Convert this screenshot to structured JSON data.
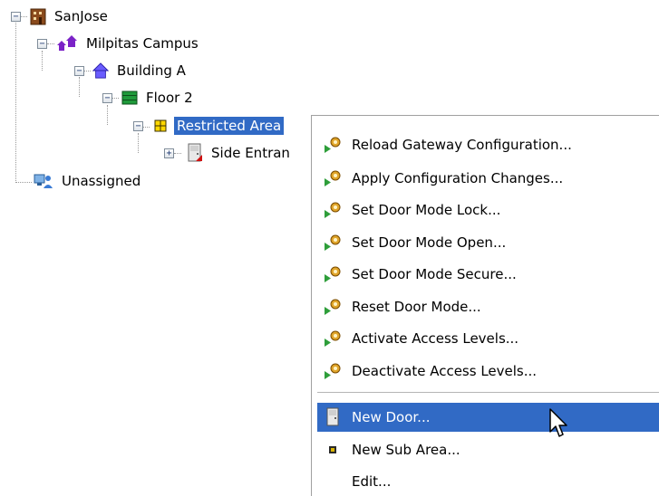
{
  "tree": {
    "root": {
      "label": "SanJose",
      "toggle": "−",
      "icon": "building-brown-icon"
    },
    "campus": {
      "label": "Milpitas Campus",
      "toggle": "−",
      "icon": "campus-houses-icon"
    },
    "building": {
      "label": "Building A",
      "toggle": "−",
      "icon": "house-blue-icon"
    },
    "floor": {
      "label": "Floor 2",
      "toggle": "−",
      "icon": "floor-green-icon"
    },
    "area": {
      "label": "Restricted Area",
      "toggle": "−",
      "icon": "area-yellow-icon"
    },
    "door": {
      "label": "Side Entran",
      "toggle": "+",
      "icon": "door-icon"
    },
    "unassigned": {
      "label": "Unassigned",
      "icon": "network-users-icon"
    }
  },
  "context_menu": {
    "items": [
      {
        "label": "Reload Gateway Configuration...",
        "icon": "gear-action-icon"
      },
      {
        "label": "Apply Configuration Changes...",
        "icon": "gear-action-icon"
      },
      {
        "label": "Set Door Mode Lock...",
        "icon": "gear-action-icon"
      },
      {
        "label": "Set Door Mode Open...",
        "icon": "gear-action-icon"
      },
      {
        "label": "Set Door Mode Secure...",
        "icon": "gear-action-icon"
      },
      {
        "label": "Reset Door Mode...",
        "icon": "gear-action-icon"
      },
      {
        "label": "Activate Access Levels...",
        "icon": "gear-action-icon"
      },
      {
        "label": "Deactivate Access Levels...",
        "icon": "gear-action-icon"
      },
      {
        "label": "New Door...",
        "icon": "door-icon",
        "highlighted": true
      },
      {
        "label": "New Sub Area...",
        "icon": "small-square-icon"
      },
      {
        "label": "Edit...",
        "icon": "none"
      }
    ]
  },
  "colors": {
    "selection": "#316ac5",
    "menu_border": "#a0a0a0",
    "tree_lines": "#9a9a9a"
  }
}
